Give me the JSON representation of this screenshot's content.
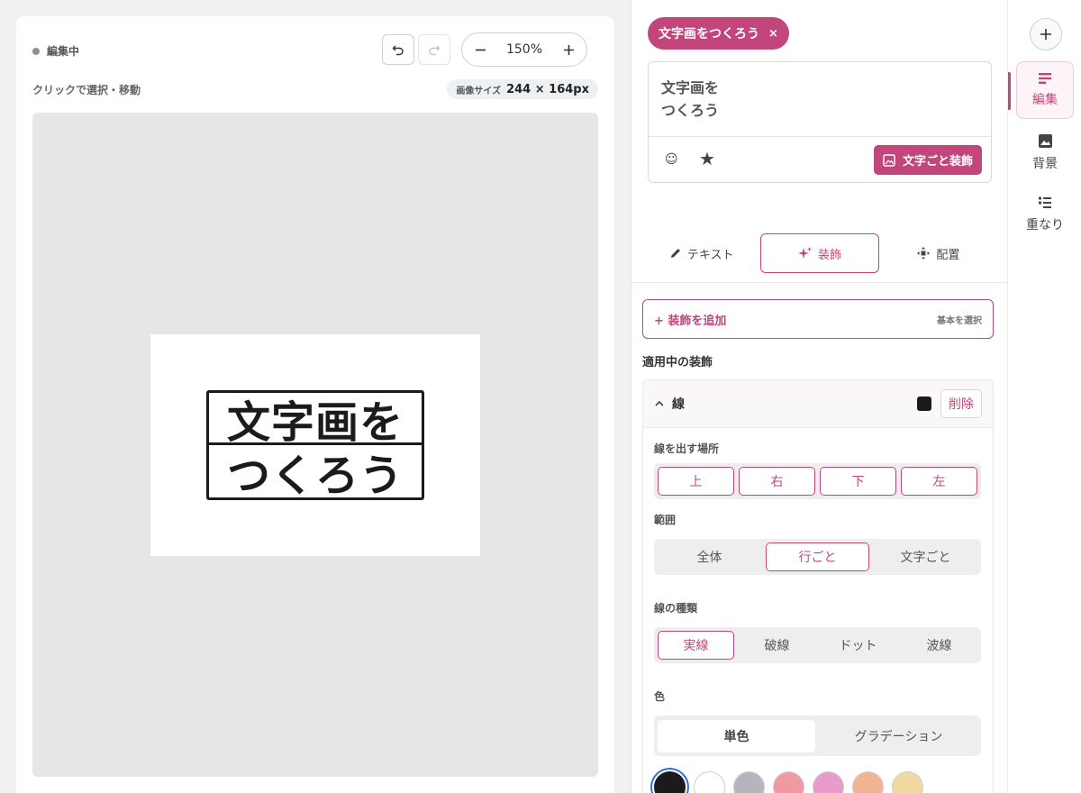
{
  "canvas": {
    "status_label": "編集中",
    "zoom_value": "150%",
    "hint": "クリックで選択・移動",
    "size_label": "画像サイズ",
    "size_value": "244 × 164px",
    "artwork_lines": [
      "文字画を",
      "つくろう"
    ]
  },
  "editor": {
    "chip_label": "文字画をつくろう",
    "chip_close": "×",
    "text": "文字画を\nつくろう",
    "emoji_icon": "☺",
    "star_icon": "★",
    "char_decorate_label": "文字ごと装飾"
  },
  "tabs": [
    {
      "label": "テキスト",
      "icon": "pencil-icon",
      "active": false
    },
    {
      "label": "装飾",
      "icon": "sparkle-icon",
      "active": true
    },
    {
      "label": "配置",
      "icon": "move-icon",
      "active": false
    }
  ],
  "decoration": {
    "add_label": "+ 装飾を追加",
    "add_sub": "基本を選択",
    "applied_title": "適用中の装飾",
    "item_name": "線",
    "item_color": "#1b1b1b",
    "delete_label": "削除",
    "position_title": "線を出す場所",
    "positions": [
      "上",
      "右",
      "下",
      "左"
    ],
    "range_title": "範囲",
    "ranges": [
      "全体",
      "行ごと",
      "文字ごと"
    ],
    "range_selected": "行ごと",
    "type_title": "線の種類",
    "types": [
      "実線",
      "破線",
      "ドット",
      "波線"
    ],
    "type_selected": "実線",
    "color_title": "色",
    "color_modes": [
      "単色",
      "グラデーション"
    ],
    "color_mode_selected": "単色",
    "swatches": [
      "#1b1b1b",
      "#ffffff",
      "#b8b4bd",
      "#ef9aa3",
      "#e89ccb",
      "#f0b493",
      "#f2d9a1"
    ],
    "swatch_selected": "#1b1b1b"
  },
  "sidebar": {
    "add_icon": "+",
    "items": [
      {
        "label": "編集",
        "icon": "edit-icon",
        "active": true
      },
      {
        "label": "背景",
        "icon": "image-icon",
        "active": false
      },
      {
        "label": "重なり",
        "icon": "layers-icon",
        "active": false
      }
    ]
  },
  "colors": {
    "accent": "#c2467c",
    "stage": "#e6e6e7",
    "ink": "#1b1b1b"
  }
}
